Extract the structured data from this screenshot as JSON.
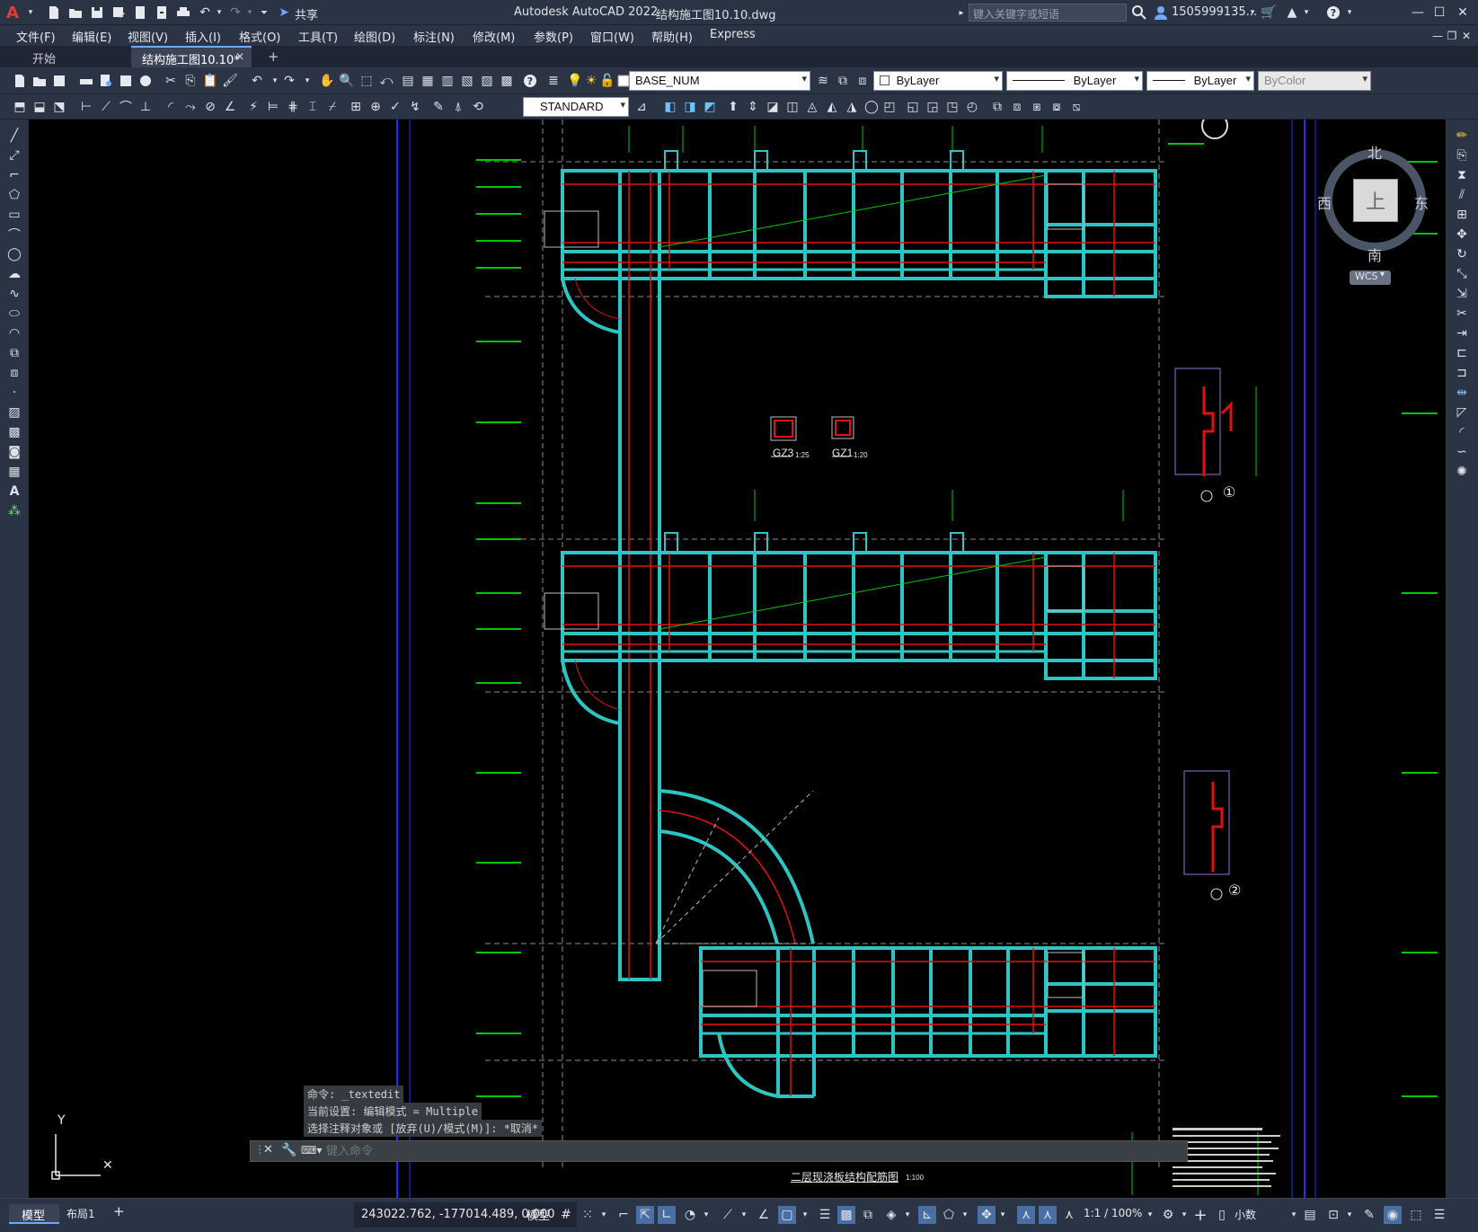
{
  "app": {
    "title": "Autodesk AutoCAD 2022",
    "filename": "结构施工图10.10.dwg",
    "search_placeholder": "键入关键字或短语",
    "user": "1505999135...",
    "share_label": "共享"
  },
  "menu": [
    "文件(F)",
    "编辑(E)",
    "视图(V)",
    "插入(I)",
    "格式(O)",
    "工具(T)",
    "绘图(D)",
    "标注(N)",
    "修改(M)",
    "参数(P)",
    "窗口(W)",
    "帮助(H)",
    "Express"
  ],
  "tabs": {
    "start": "开始",
    "active": "结构施工图10.10*",
    "add": "+"
  },
  "toolbar": {
    "layer": "BASE_NUM",
    "color": "ByLayer",
    "linetype": "ByLayer",
    "lineweight": "ByLayer",
    "plotstyle": "ByColor",
    "textstyle": "STANDARD"
  },
  "viewcube": {
    "north": "北",
    "south": "南",
    "east": "东",
    "west": "西",
    "top": "上",
    "wcs": "WCS"
  },
  "drawing": {
    "label_gz3": "GZ3",
    "scale_gz3": "1:25",
    "label_gz1": "GZ1",
    "scale_gz1": "1:20",
    "callout1": "①",
    "callout2": "②",
    "plan_title": "二层现浇板结构配筋图",
    "plan_scale": "1:100"
  },
  "ucs": {
    "y": "Y"
  },
  "command": {
    "history": [
      "命令: _textedit",
      "当前设置: 编辑模式 = Multiple",
      "选择注释对象或 [放弃(U)/模式(M)]: *取消*"
    ],
    "placeholder": "键入命令"
  },
  "status": {
    "model_tab": "模型",
    "layout_tab": "布局1",
    "coords": "243022.762, -177014.489, 0.000",
    "space": "模型",
    "scale": "1:1 / 100%",
    "units": "小数"
  }
}
